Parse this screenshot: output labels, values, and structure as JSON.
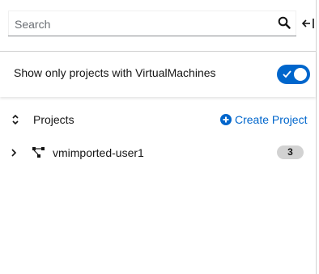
{
  "search": {
    "placeholder": "Search",
    "value": ""
  },
  "filter": {
    "label": "Show only projects with VirtualMachines",
    "enabled": true,
    "accent": "#0066cc"
  },
  "projects": {
    "title": "Projects",
    "create_label": "Create Project",
    "items": [
      {
        "name": "vmimported-user1",
        "count": "3",
        "expanded": false
      }
    ]
  }
}
